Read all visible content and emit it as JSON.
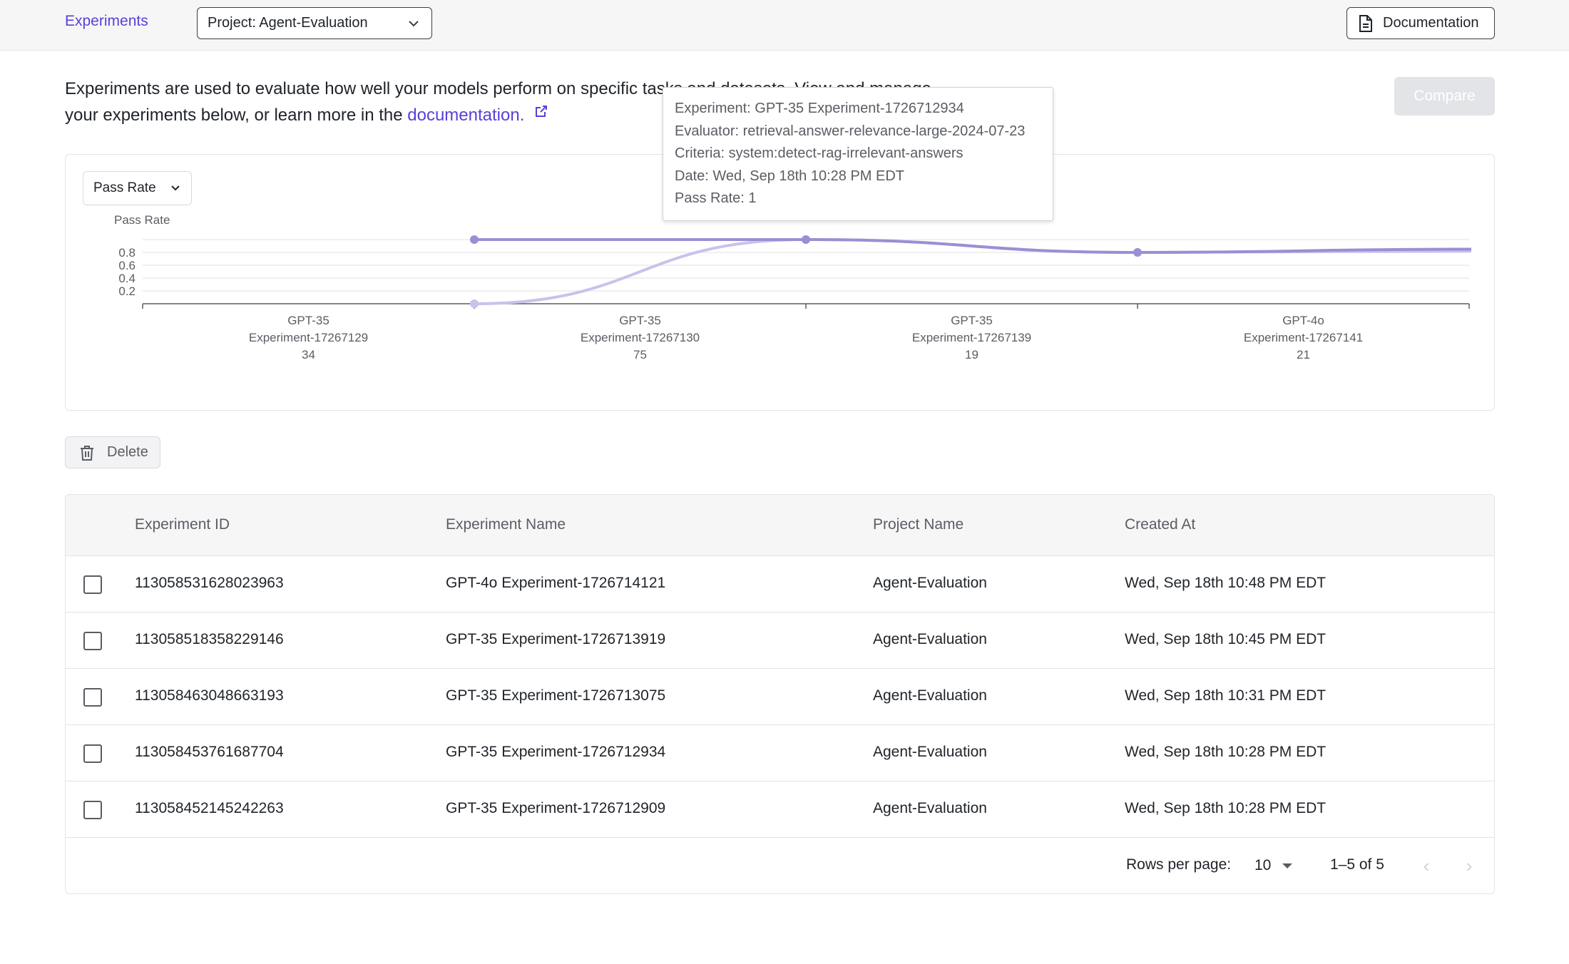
{
  "nav": {
    "experiments_tab": "Experiments",
    "project_select": "Project: Agent-Evaluation",
    "documentation_button": "Documentation"
  },
  "intro": {
    "text_line1": "Experiments are used to evaluate how well your models perform on specific tasks and datasets. View and manage",
    "text_line2": "your experiments below, or learn more in the",
    "link": "documentation."
  },
  "compare_button": "Compare",
  "metric_select": "Pass Rate",
  "chart_data": {
    "type": "line",
    "ylabel": "Pass Rate",
    "yticks": [
      "0.8",
      "0.6",
      "0.4",
      "0.2"
    ],
    "ylim": [
      0,
      1
    ],
    "categories": [
      [
        "GPT-35",
        "Experiment-17267129",
        "34"
      ],
      [
        "GPT-35",
        "Experiment-17267130",
        "75"
      ],
      [
        "GPT-35",
        "Experiment-17267139",
        "19"
      ],
      [
        "GPT-4o",
        "Experiment-17267141",
        "21"
      ]
    ],
    "series": [
      {
        "values": [
          null,
          1,
          1,
          0.8,
          0.85
        ],
        "color": "#9a8fd3"
      },
      {
        "values": [
          null,
          0,
          1,
          0.8,
          0.82
        ],
        "color": "#c9c2ec"
      }
    ],
    "grid": true
  },
  "tooltip": {
    "line1": "Experiment: GPT-35 Experiment-1726712934",
    "line2": "Evaluator: retrieval-answer-relevance-large-2024-07-23",
    "line3": "Criteria: system:detect-rag-irrelevant-answers",
    "line4": "Date: Wed, Sep 18th 10:28 PM EDT",
    "line5": "Pass Rate: 1"
  },
  "delete_button": "Delete",
  "table": {
    "headers": [
      "Experiment ID",
      "Experiment Name",
      "Project Name",
      "Created At"
    ],
    "rows": [
      [
        "113058531628023963",
        "GPT-4o Experiment-1726714121",
        "Agent-Evaluation",
        "Wed, Sep 18th 10:48 PM EDT"
      ],
      [
        "113058518358229146",
        "GPT-35 Experiment-1726713919",
        "Agent-Evaluation",
        "Wed, Sep 18th 10:45 PM EDT"
      ],
      [
        "113058463048663193",
        "GPT-35 Experiment-1726713075",
        "Agent-Evaluation",
        "Wed, Sep 18th 10:31 PM EDT"
      ],
      [
        "113058453761687704",
        "GPT-35 Experiment-1726712934",
        "Agent-Evaluation",
        "Wed, Sep 18th 10:28 PM EDT"
      ],
      [
        "113058452145242263",
        "GPT-35 Experiment-1726712909",
        "Agent-Evaluation",
        "Wed, Sep 18th 10:28 PM EDT"
      ]
    ]
  },
  "pagination": {
    "rows_per_page_label": "Rows per page:",
    "rows_per_page_value": "10",
    "range": "1–5 of 5",
    "prev_icon": "chevron-left-icon",
    "next_icon": "chevron-right-icon"
  }
}
